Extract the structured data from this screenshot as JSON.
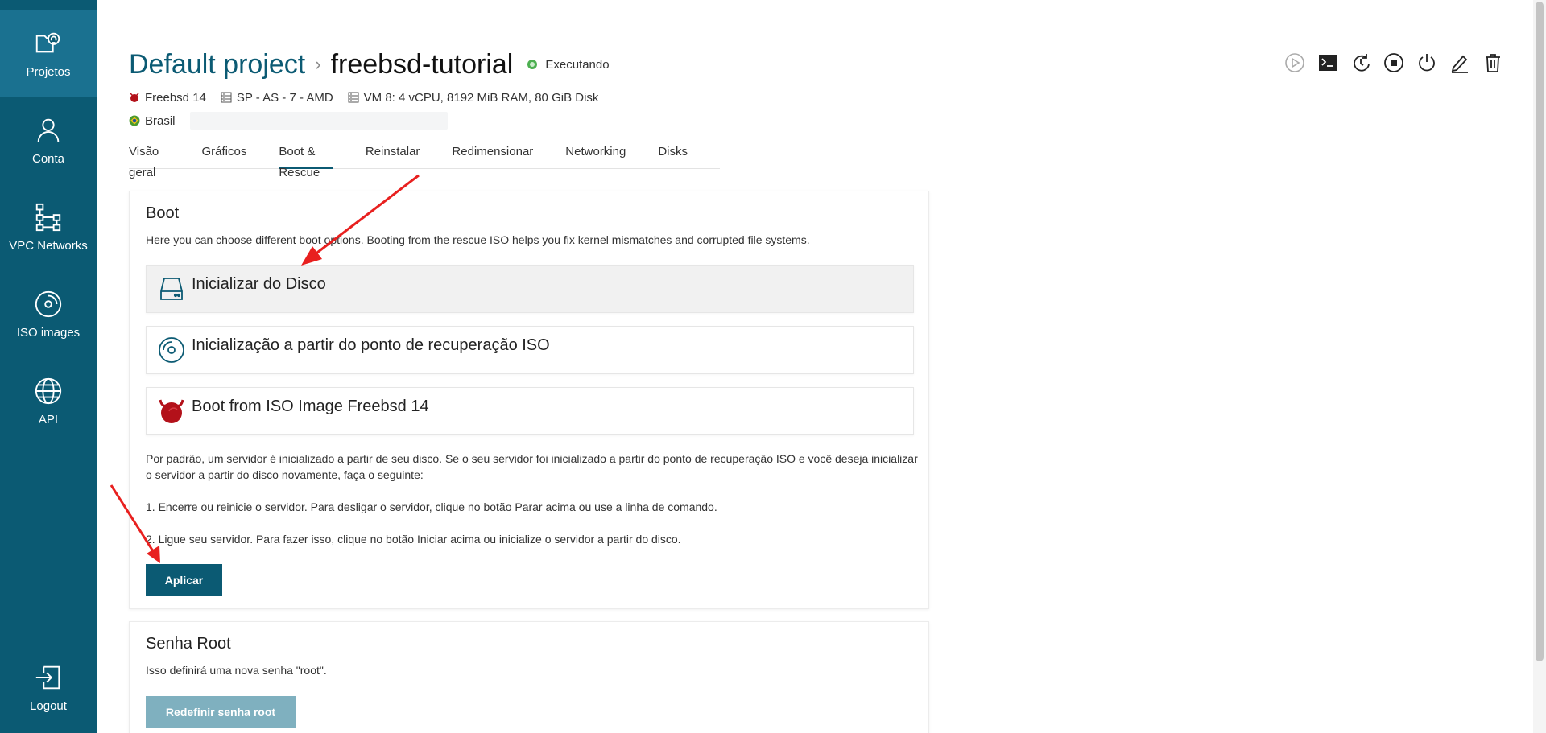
{
  "sidebar": {
    "items": [
      {
        "label": "Projetos",
        "icon": "projects-icon",
        "active": true
      },
      {
        "label": "Conta",
        "icon": "user-icon"
      },
      {
        "label": "VPC Networks",
        "icon": "network-icon"
      },
      {
        "label": "ISO images",
        "icon": "disc-icon"
      },
      {
        "label": "API",
        "icon": "globe-icon"
      }
    ],
    "logout": {
      "label": "Logout",
      "icon": "logout-icon"
    }
  },
  "header": {
    "project": "Default project",
    "separator": "›",
    "server": "freebsd-tutorial",
    "status": "Executando",
    "os": "Freebsd 14",
    "location_code": "SP - AS - 7 - AMD",
    "specs": "VM 8: 4 vCPU, 8192 MiB RAM, 80 GiB Disk",
    "country": "Brasil"
  },
  "actions": [
    "play-icon",
    "console-icon",
    "restart-icon",
    "stop-icon",
    "power-icon",
    "edit-icon",
    "trash-icon"
  ],
  "tabs": [
    {
      "label": "Visão geral"
    },
    {
      "label": "Gráficos"
    },
    {
      "label": "Boot & Rescue",
      "active": true
    },
    {
      "label": "Reinstalar"
    },
    {
      "label": "Redimensionar"
    },
    {
      "label": "Networking"
    },
    {
      "label": "Disks"
    }
  ],
  "boot": {
    "title": "Boot",
    "description": "Here you can choose different boot options. Booting from the rescue ISO helps you fix kernel mismatches and corrupted file systems.",
    "options": [
      {
        "label": "Inicializar do Disco",
        "icon": "hard-drive-icon",
        "selected": true
      },
      {
        "label": "Inicialização a partir do ponto de recuperação ISO",
        "icon": "rescue-disc-icon"
      },
      {
        "label": "Boot from ISO Image Freebsd 14",
        "icon": "freebsd-logo-icon"
      }
    ],
    "paragraph1": "Por padrão, um servidor é inicializado a partir de seu disco. Se o seu servidor foi inicializado a partir do ponto de recuperação ISO e você deseja inicializar o servidor a partir do disco novamente, faça o seguinte:",
    "step1": "1. Encerre ou reinicie o servidor. Para desligar o servidor, clique no botão Parar acima ou use a linha de comando.",
    "step2": "2. Ligue seu servidor. Para fazer isso, clique no botão Iniciar acima ou inicialize o servidor a partir do disco.",
    "apply_label": "Aplicar"
  },
  "root_password": {
    "title": "Senha Root",
    "description": "Isso definirá uma nova senha \"root\".",
    "reset_label": "Redefinir senha root"
  },
  "colors": {
    "sidebar": "#0b5a73",
    "accent": "#0b5a73",
    "status": "#4caf50",
    "annotation": "#e8201f"
  }
}
